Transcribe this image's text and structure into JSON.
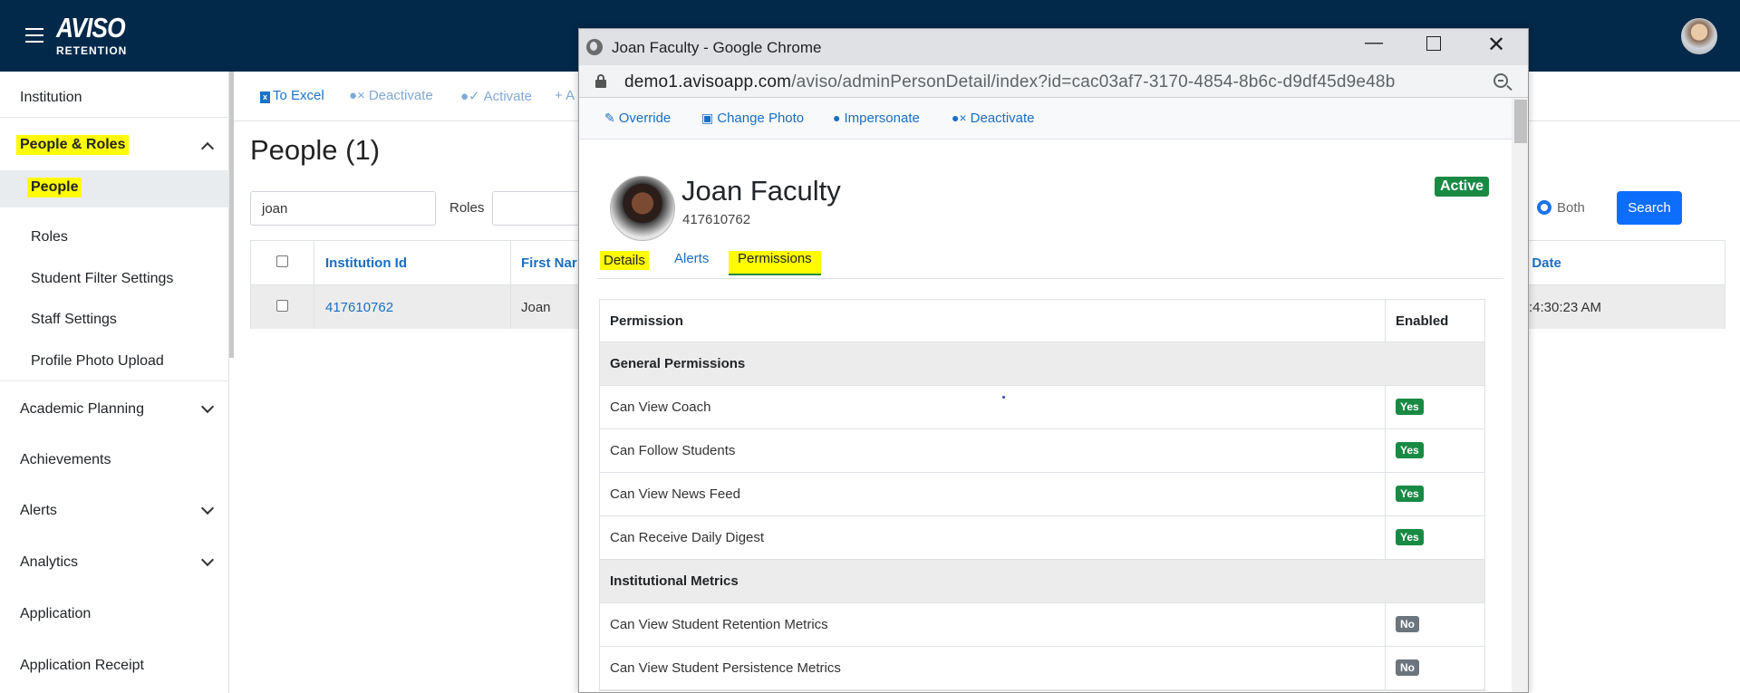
{
  "app": {
    "logo_main": "AVISO",
    "logo_sub": "RETENTION"
  },
  "sidebar": {
    "institution": "Institution",
    "people_roles": "People & Roles",
    "sub_items": [
      "People",
      "Roles",
      "Student Filter Settings",
      "Staff Settings",
      "Profile Photo Upload"
    ],
    "items": [
      "Academic Planning",
      "Achievements",
      "Alerts",
      "Analytics",
      "Application",
      "Application Receipt"
    ]
  },
  "toolbar": {
    "to_excel": "To Excel",
    "deactivate": "Deactivate",
    "activate": "Activate",
    "add": "+ A"
  },
  "main": {
    "title": "People (1)",
    "search_value": "joan",
    "roles_label": "Roles",
    "radio_label": "Both",
    "search_button": "Search",
    "columns": [
      "Institution Id",
      "First Nar",
      "d Date"
    ],
    "row": {
      "institution_id": "417610762",
      "first_name": "Joan",
      "date": ":4:30:23 AM"
    }
  },
  "popup": {
    "title": "Joan Faculty - Google Chrome",
    "url_host": "demo1.avisoapp.com",
    "url_path": "/aviso/adminPersonDetail/index?id=cac03af7-3170-4854-8b6c-d9df45d9e48b",
    "toolbar": [
      "Override",
      "Change Photo",
      "Impersonate",
      "Deactivate"
    ],
    "person_name": "Joan Faculty",
    "person_id": "417610762",
    "status": "Active",
    "tabs": [
      "Details",
      "Alerts",
      "Permissions"
    ],
    "table_headers": [
      "Permission",
      "Enabled"
    ],
    "groups": [
      {
        "name": "General Permissions",
        "rows": [
          {
            "label": "Can View Coach",
            "value": "Yes"
          },
          {
            "label": "Can Follow Students",
            "value": "Yes"
          },
          {
            "label": "Can View News Feed",
            "value": "Yes"
          },
          {
            "label": "Can Receive Daily Digest",
            "value": "Yes"
          }
        ]
      },
      {
        "name": "Institutional Metrics",
        "rows": [
          {
            "label": "Can View Student Retention Metrics",
            "value": "No"
          },
          {
            "label": "Can View Student Persistence Metrics",
            "value": "No"
          }
        ]
      }
    ]
  },
  "colors": {
    "topbar": "#03294a",
    "link": "#1a6ec2",
    "highlight": "#fffb00",
    "success": "#198a43",
    "primary_button": "#0d6efd"
  }
}
